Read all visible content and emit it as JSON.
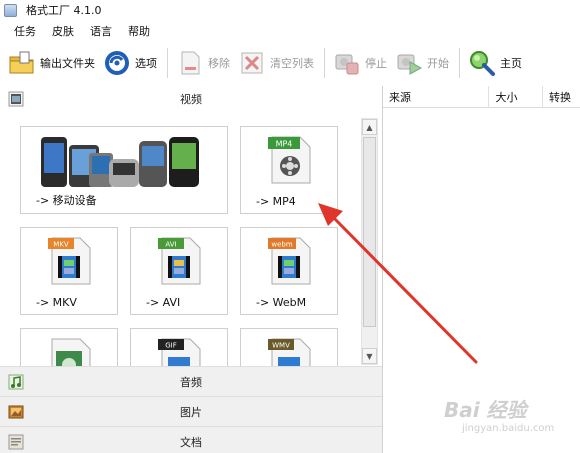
{
  "window": {
    "title": "格式工厂 4.1.0"
  },
  "menu": [
    "任务",
    "皮肤",
    "语言",
    "帮助"
  ],
  "toolbar": {
    "output_folder": "输出文件夹",
    "options": "选项",
    "remove": "移除",
    "clear_list": "清空列表",
    "stop": "停止",
    "start": "开始",
    "home": "主页"
  },
  "categories": {
    "video": "视频",
    "audio": "音频",
    "image": "图片",
    "document": "文档"
  },
  "tiles": {
    "mobile": "-> 移动设备",
    "mp4": "-> MP4",
    "mkv": "-> MKV",
    "avi": "-> AVI",
    "webm": "-> WebM",
    "mp4_badge": "MP4",
    "mkv_badge": "MKV",
    "avi_badge": "AVI",
    "webm_badge": "webm",
    "gif_badge": "GIF",
    "wmv_badge": "WMV"
  },
  "task_list": {
    "columns": [
      "来源",
      "大小",
      "转换"
    ]
  },
  "watermark": {
    "logo": "Bai 经验",
    "url": "jingyan.baidu.com"
  },
  "colors": {
    "arrow": "#e0352b",
    "mp4_badge": "#3a9a3a",
    "mkv_badge": "#e8852a",
    "avi_badge": "#4a9a3a",
    "webm_badge": "#e07a2a",
    "gif_badge": "#222222",
    "wmv_badge": "#6a5a2a"
  }
}
